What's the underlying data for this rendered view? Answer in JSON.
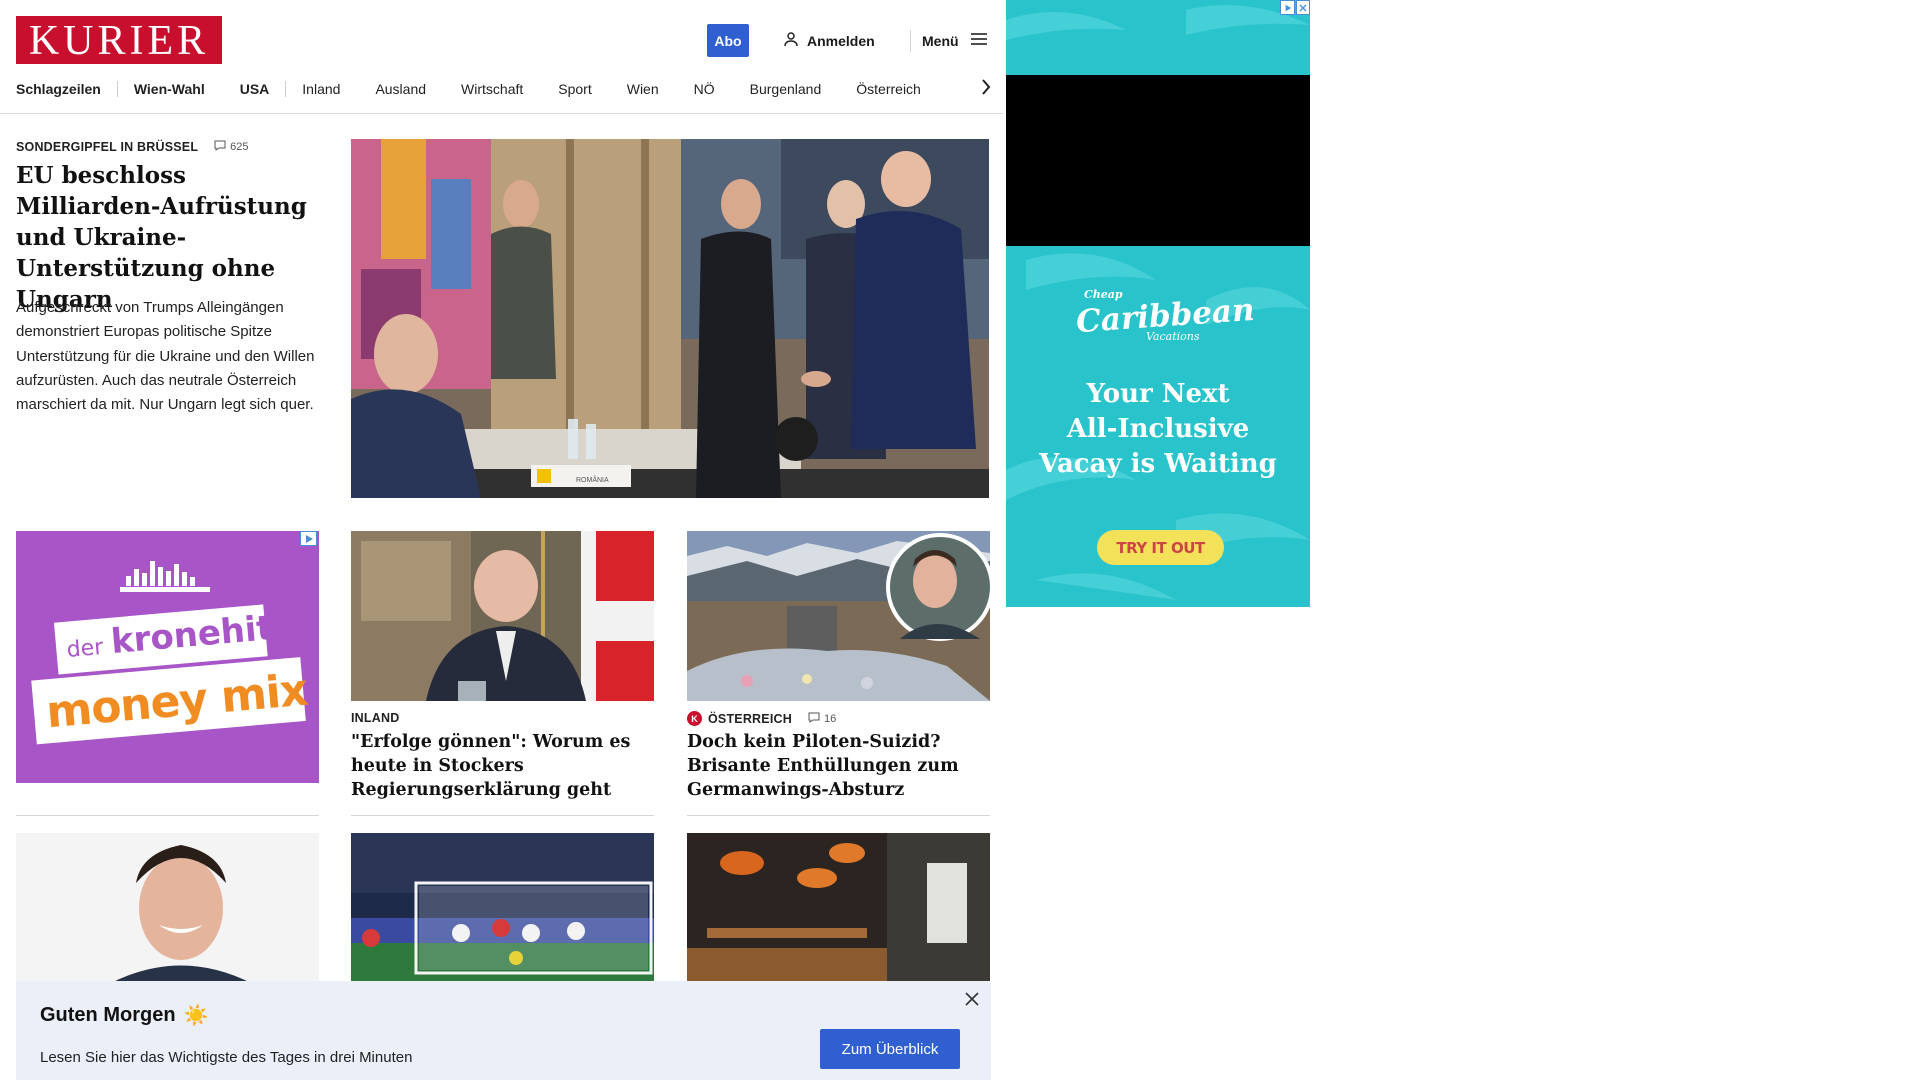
{
  "header": {
    "logo": "KURIER",
    "abo_label": "Abo",
    "login_label": "Anmelden",
    "menu_label": "Menü",
    "nav": [
      {
        "label": "Schlagzeilen",
        "bold": true
      },
      {
        "label": "Wien-Wahl",
        "bold": true
      },
      {
        "label": "USA",
        "bold": true
      },
      {
        "label": "Inland",
        "bold": false
      },
      {
        "label": "Ausland",
        "bold": false
      },
      {
        "label": "Wirtschaft",
        "bold": false
      },
      {
        "label": "Sport",
        "bold": false
      },
      {
        "label": "Wien",
        "bold": false
      },
      {
        "label": "NÖ",
        "bold": false
      },
      {
        "label": "Burgenland",
        "bold": false
      },
      {
        "label": "Österreich",
        "bold": false
      }
    ]
  },
  "hero": {
    "kicker": "SONDERGIPFEL IN BRÜSSEL",
    "comments": "625",
    "title": "EU beschloss Milliarden-Aufrüstung und Ukraine-Unterstützung ohne Ungarn",
    "teaser": "Aufgeschreckt von Trumps Alleingängen demonstriert Europas politische Spitze Unterstützung für die Ukraine und den Willen aufzurüsten. Auch das neutrale Österreich marschiert da mit. Nur Ungarn legt sich quer.",
    "image_caption": "ROMÂNIA"
  },
  "ad_left": {
    "line1": "der",
    "line2": "kronehit",
    "line3": "money mix"
  },
  "cards": [
    {
      "kicker": "INLAND",
      "title": "\"Erfolge gönnen\": Worum es heute in Stockers Regierungserklärung geht"
    },
    {
      "kicker": "ÖSTERREICH",
      "badge": "K",
      "comments": "16",
      "title": "Doch kein Piloten-Suizid? Brisante Enthüllungen zum Germanwings-Absturz"
    }
  ],
  "ad_right": {
    "brand_small_top": "Cheap",
    "brand_main": "Caribbean",
    "brand_small_bottom": "Vacations",
    "headline_1": "Your Next",
    "headline_2": "All-Inclusive",
    "headline_3": "Vacay is Waiting",
    "cta": "TRY IT OUT"
  },
  "banner": {
    "title": "Guten Morgen",
    "emoji": "☀️",
    "text": "Lesen Sie hier das Wichtigste des Tages in drei Minuten",
    "button": "Zum Überblick"
  },
  "colors": {
    "brand_red": "#c8102e",
    "accent_blue": "#2f5fd1",
    "ad_purple": "#a855c8",
    "ad_turquoise": "#29c3cc",
    "banner_bg": "#eaeff8"
  }
}
